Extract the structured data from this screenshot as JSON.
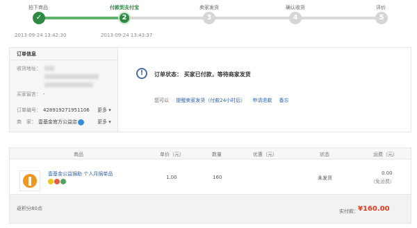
{
  "steps": [
    {
      "label": "拍下商品",
      "num": "✓",
      "time": "2013-09-24 13:42:30"
    },
    {
      "label": "付款到支付宝",
      "num": "2",
      "time": "2013-09-24 13:43:37"
    },
    {
      "label": "卖家发货",
      "num": "3",
      "time": ""
    },
    {
      "label": "确认收货",
      "num": "4",
      "time": ""
    },
    {
      "label": "评价",
      "num": "5",
      "time": ""
    }
  ],
  "order_info": {
    "title": "订单信息",
    "address_label": "收货地址：",
    "message_label": "买家留言：",
    "message_value": "-",
    "order_no_label": "订单编号：",
    "order_no_value": "428919271951106",
    "seller_label": "商　家：",
    "seller_value": "壹基金官方公益店",
    "more_label": "更多"
  },
  "status": {
    "icon": "!",
    "text": "订单状态：  买家已付款，等待商家发货",
    "you_can": "您可以",
    "remind": "提醒卖家发货（付款24小时后）",
    "refund": "申请退款",
    "memo": "备忘"
  },
  "table": {
    "headers": [
      "商品",
      "单价（元）",
      "数量",
      "优惠（元）",
      "状态",
      "运费（元）"
    ],
    "rows": [
      {
        "name": "壹基金公益捐助 个人月捐单品",
        "price": "1.00",
        "qty": "160",
        "discount": "",
        "status": "未发货",
        "shipping": "0.00",
        "shipping_note": "（免运费）"
      }
    ]
  },
  "footer": {
    "points": "返积分80点",
    "total_label": "实付款：",
    "total_value": "¥160.00"
  },
  "colors": {
    "accent": "#2f8a46",
    "price": "#e03b1b",
    "link": "#2b62b0"
  }
}
